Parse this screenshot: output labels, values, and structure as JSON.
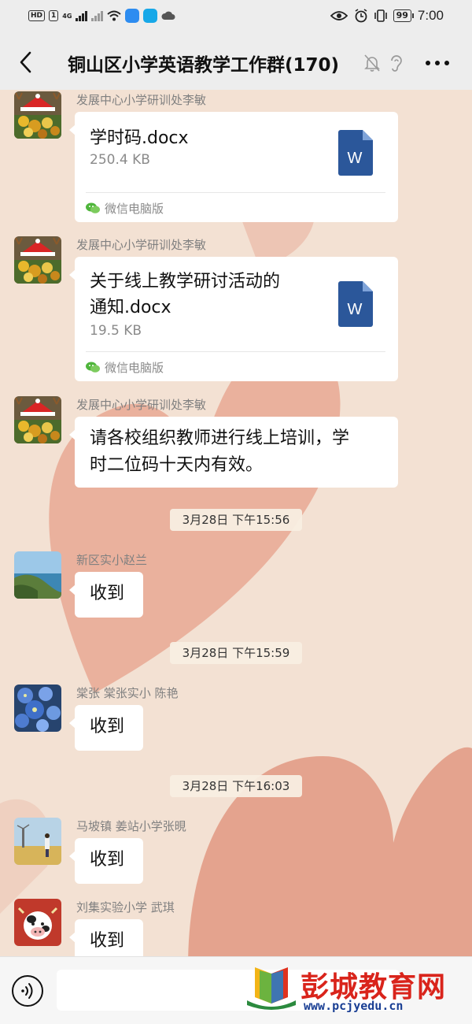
{
  "status_bar": {
    "left": {
      "hd": "HD",
      "sim": "1",
      "net": "4G"
    },
    "battery": "99",
    "time": "7:00"
  },
  "header": {
    "title": "铜山区小学英语教学工作群(170)"
  },
  "messages": [
    {
      "sender": "发展中心小学研训处李敏",
      "type": "file",
      "file_name": "学时码.docx",
      "file_size": "250.4 KB",
      "source": "微信电脑版"
    },
    {
      "sender": "发展中心小学研训处李敏",
      "type": "file",
      "file_name_line1": "关于线上教学研讨活动的",
      "file_name_line2": "通知.docx",
      "file_size": "19.5 KB",
      "source": "微信电脑版"
    },
    {
      "sender": "发展中心小学研训处李敏",
      "type": "text",
      "text_line1": "请各校组织教师进行线上培训，学",
      "text_line2": "时二位码十天内有效。"
    },
    {
      "type": "time",
      "time": "3月28日 下午15:56"
    },
    {
      "sender": "新区实小赵兰",
      "type": "text",
      "text": "收到"
    },
    {
      "type": "time",
      "time": "3月28日 下午15:59"
    },
    {
      "sender": "棠张 棠张实小 陈艳",
      "type": "text",
      "text": "收到"
    },
    {
      "type": "time",
      "time": "3月28日 下午16:03"
    },
    {
      "sender": "马坡镇 姜站小学张晛",
      "type": "text",
      "text": "收到"
    },
    {
      "sender": "刘集实验小学 武琪",
      "type": "text",
      "text": "收到"
    }
  ],
  "file_icon_letter": "W",
  "input": {
    "value": "",
    "placeholder": ""
  },
  "watermark": {
    "title": "彭城教育网",
    "url": "www.pcjyedu.cn"
  },
  "colors": {
    "background": "#f3e1d3",
    "heart": "#e4a18c",
    "bubble": "#ffffff",
    "word_blue": "#2b579a",
    "wechat_green": "#4fb53c",
    "watermark_red": "#d9241b"
  },
  "icons": {
    "back": "chevron-left-icon",
    "mute": "bell-slash-icon",
    "ear": "ear-icon",
    "more": "more-dots-icon",
    "voice": "voice-icon",
    "file": "word-file-icon",
    "source": "wechat-icon"
  }
}
